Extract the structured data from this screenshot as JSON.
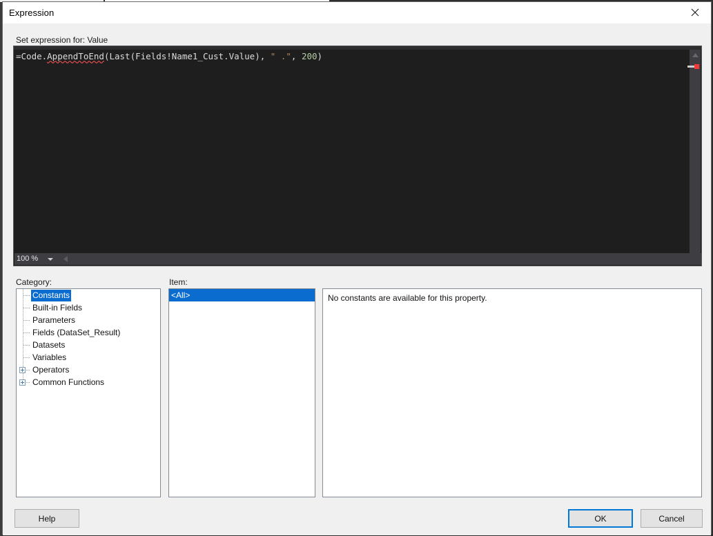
{
  "window": {
    "title": "Expression",
    "close_icon": "close-icon"
  },
  "editor": {
    "label": "Set expression for: Value",
    "expression_full": "=Code.AppendToEnd(Last(Fields!Name1_Cust.Value), \" .\", 200)",
    "tokens": {
      "part1": "=Code.",
      "part2_squiggled": "AppendToEnd",
      "part3": "(Last(Fields!Name1_Cust.Value), ",
      "string_literal": "\" .\"",
      "part4": ", ",
      "number_literal": "200",
      "part5": ")"
    },
    "zoom_level": "100 %",
    "scroll_up_icon": "caret-up-icon",
    "scroll_down_icon": "caret-down-icon",
    "hscroll_left_icon": "caret-left-icon",
    "hscroll_right_icon": "caret-right-icon",
    "error_marker_color": "#f03a3a",
    "change_marker_color": "#cfcfcf"
  },
  "category": {
    "label": "Category:",
    "items": [
      {
        "label": "Constants",
        "selected": true,
        "expandable": false
      },
      {
        "label": "Built-in Fields",
        "selected": false,
        "expandable": false
      },
      {
        "label": "Parameters",
        "selected": false,
        "expandable": false
      },
      {
        "label": "Fields (DataSet_Result)",
        "selected": false,
        "expandable": false
      },
      {
        "label": "Datasets",
        "selected": false,
        "expandable": false
      },
      {
        "label": "Variables",
        "selected": false,
        "expandable": false
      },
      {
        "label": "Operators",
        "selected": false,
        "expandable": true
      },
      {
        "label": "Common Functions",
        "selected": false,
        "expandable": true
      }
    ]
  },
  "item": {
    "label": "Item:",
    "items": [
      {
        "label": "<All>",
        "selected": true
      }
    ]
  },
  "description": {
    "text": "No constants are available for this property."
  },
  "buttons": {
    "help": "Help",
    "ok": "OK",
    "cancel": "Cancel"
  },
  "colors": {
    "accent": "#0078d7",
    "selection": "#0b6cd0",
    "dialog_bg": "#f0f0f0",
    "editor_bg": "#1e1e1e",
    "string_token": "#b5895b",
    "number_token": "#b5cea8",
    "squiggle": "#d84a4a"
  }
}
